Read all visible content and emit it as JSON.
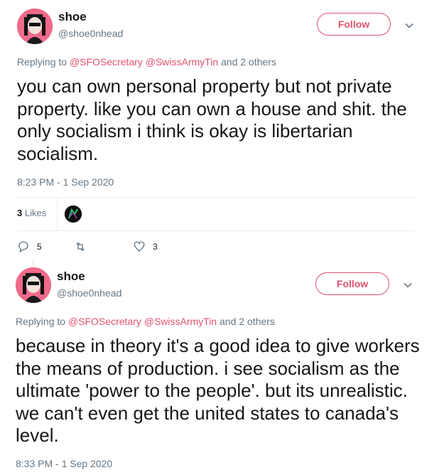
{
  "tweets": [
    {
      "name": "shoe",
      "handle": "@shoe0nhead",
      "follow_label": "Follow",
      "reply_prefix": "Replying to ",
      "mention1": "@SFOSecretary",
      "mention2": "@SwissArmyTin",
      "reply_suffix": " and 2 others",
      "text": "you can own personal property but not private property. like you can own a house and shit. the only socialism i think is okay is libertarian socialism.",
      "timestamp": "8:23 PM - 1 Sep 2020",
      "likes_count": "3",
      "likes_label": "Likes",
      "replies": "5",
      "retweets": "",
      "likes": "3"
    },
    {
      "name": "shoe",
      "handle": "@shoe0nhead",
      "follow_label": "Follow",
      "reply_prefix": "Replying to ",
      "mention1": "@SFOSecretary",
      "mention2": "@SwissArmyTin",
      "reply_suffix": " and 2 others",
      "text": "because in theory it's a good idea to give workers the means of production. i see socialism as the ultimate 'power to the people'. but its unrealistic. we can't even get the united states to canada's level.",
      "timestamp": "8:33 PM - 1 Sep 2020"
    }
  ],
  "colors": {
    "accent": "#e0526e",
    "muted": "#657786",
    "text": "#14171a",
    "divider": "#e6ecf0"
  },
  "icons": [
    "reply-icon",
    "retweet-icon",
    "like-icon",
    "chevron-down-icon"
  ]
}
